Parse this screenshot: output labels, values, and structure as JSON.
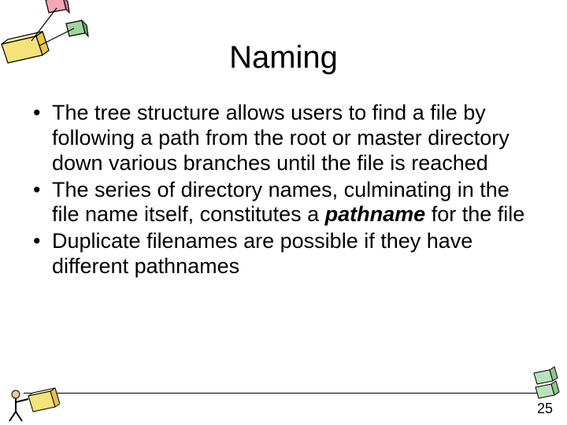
{
  "title": "Naming",
  "bullets": [
    {
      "pre": "The tree structure allows users to find a file by following a path from the root or master directory down various branches until the file is reached"
    },
    {
      "pre": "The series of directory names, culminating in the file name itself, constitutes a ",
      "term": "pathname",
      "post": " for the file"
    },
    {
      "pre": "Duplicate filenames are possible if they have different pathnames"
    }
  ],
  "page_number": "25"
}
